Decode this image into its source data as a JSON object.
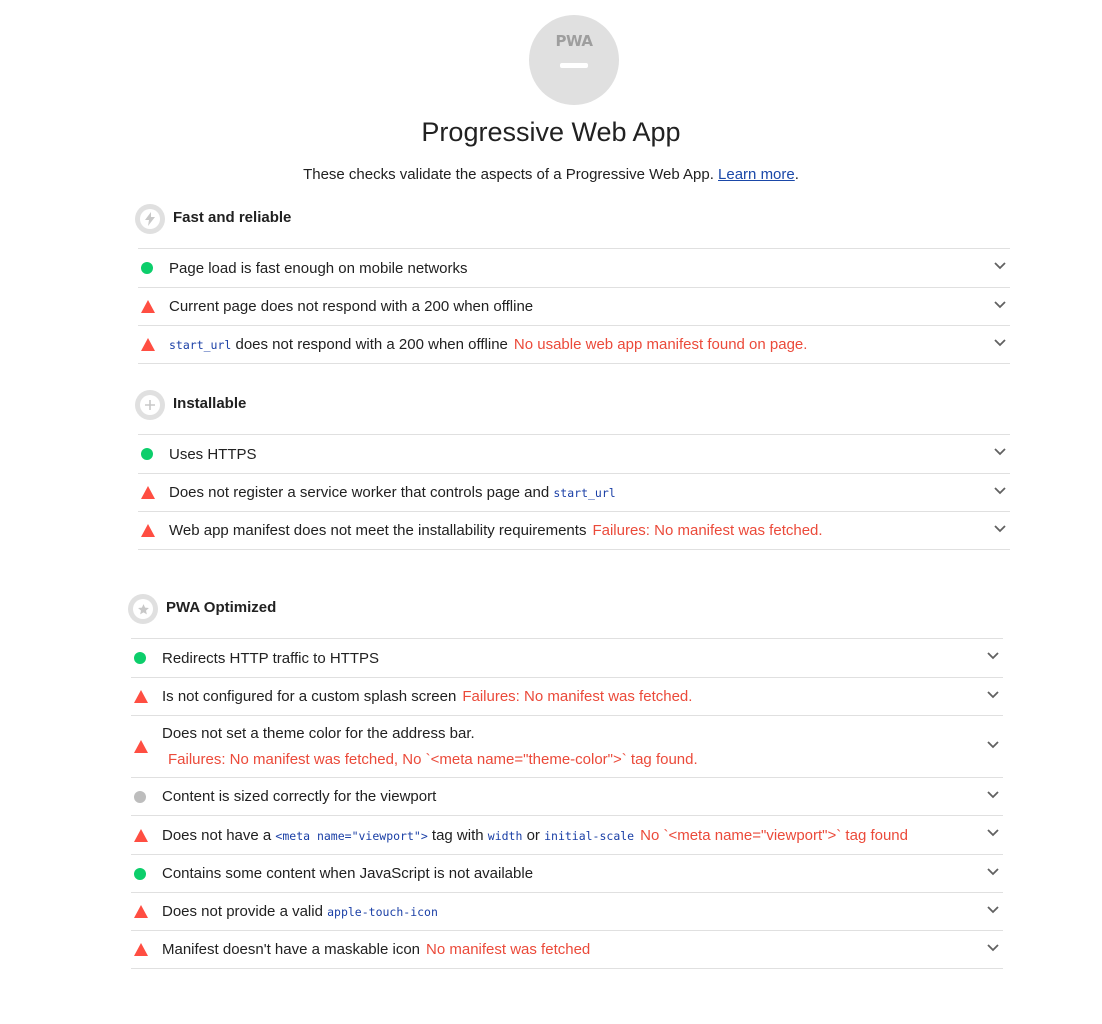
{
  "header": {
    "badge_text": "PWA",
    "title": "Progressive Web App",
    "description": "These checks validate the aspects of a Progressive Web App. ",
    "learn_more": "Learn more",
    "description_end": "."
  },
  "colors": {
    "pass": "#0cce6b",
    "fail": "#ff4e42",
    "fail_text": "#eb4a3a",
    "neutral": "#bdbdbd",
    "code": "#1a3fa6",
    "link": "#1a48a8"
  },
  "groups": [
    {
      "title": "Fast and reliable",
      "icon": "lightning-icon",
      "audits": [
        {
          "status": "pass",
          "text": "Page load is fast enough on mobile networks"
        },
        {
          "status": "fail",
          "text": "Current page does not respond with a 200 when offline"
        },
        {
          "status": "fail",
          "code": "start_url",
          "text": " does not respond with a 200 when offline",
          "failure": "No usable web app manifest found on page."
        }
      ]
    },
    {
      "title": "Installable",
      "icon": "plus-icon",
      "audits": [
        {
          "status": "pass",
          "text": "Uses HTTPS"
        },
        {
          "status": "fail",
          "text": "Does not register a service worker that controls page and ",
          "code": "start_url"
        },
        {
          "status": "fail",
          "text": "Web app manifest does not meet the installability requirements",
          "failure": "Failures: No manifest was fetched."
        }
      ]
    },
    {
      "title": "PWA Optimized",
      "icon": "star-icon",
      "audits": [
        {
          "status": "pass",
          "text": "Redirects HTTP traffic to HTTPS"
        },
        {
          "status": "fail",
          "text": "Is not configured for a custom splash screen",
          "failure": "Failures: No manifest was fetched."
        },
        {
          "status": "fail",
          "text": "Does not set a theme color for the address bar.",
          "failure": "Failures: No manifest was fetched, No `<meta name=\"theme-color\">` tag found."
        },
        {
          "status": "na",
          "text": "Content is sized correctly for the viewport"
        },
        {
          "status": "fail",
          "text_a": "Does not have a ",
          "code_a": "<meta name=\"viewport\">",
          "text_b": " tag with ",
          "code_b": "width",
          "text_c": " or ",
          "code_c": "initial-scale",
          "failure": "No `<meta name=\"viewport\">` tag found"
        },
        {
          "status": "pass",
          "text": "Contains some content when JavaScript is not available"
        },
        {
          "status": "fail",
          "text": "Does not provide a valid ",
          "code": "apple-touch-icon"
        },
        {
          "status": "fail",
          "text": "Manifest doesn't have a maskable icon",
          "failure": "No manifest was fetched"
        }
      ]
    }
  ]
}
